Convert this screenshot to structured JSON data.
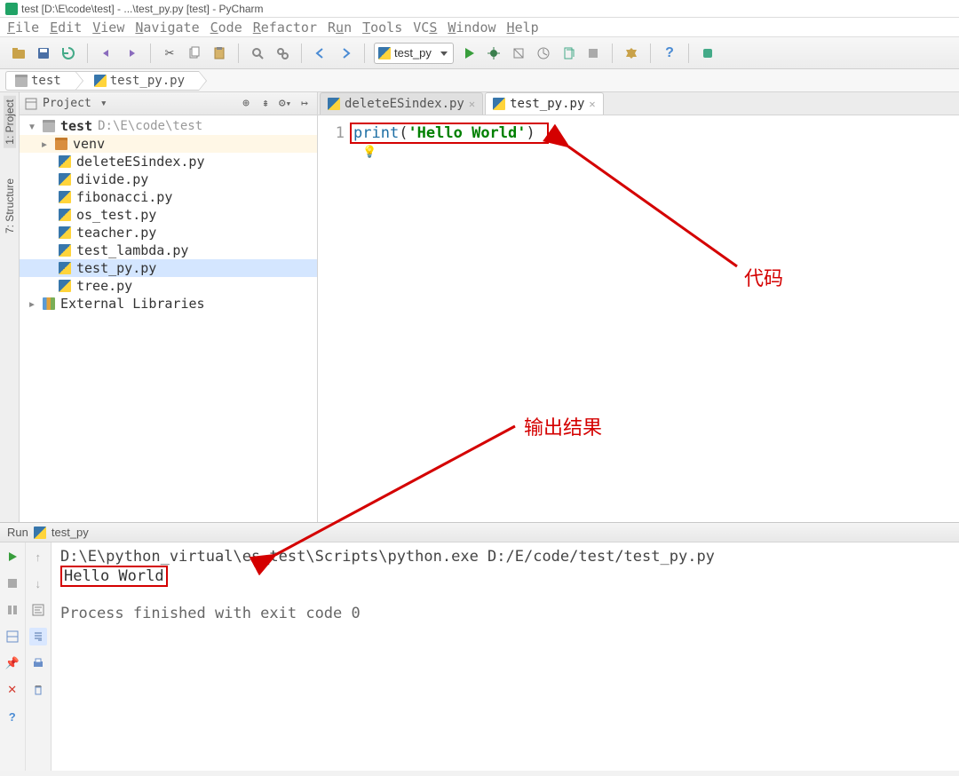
{
  "window": {
    "title": "test [D:\\E\\code\\test] - ...\\test_py.py [test] - PyCharm"
  },
  "menu": {
    "items": [
      "File",
      "Edit",
      "View",
      "Navigate",
      "Code",
      "Refactor",
      "Run",
      "Tools",
      "VCS",
      "Window",
      "Help"
    ]
  },
  "toolbar": {
    "run_config_label": "test_py"
  },
  "breadcrumb": {
    "items": [
      "test",
      "test_py.py"
    ]
  },
  "side_tabs": {
    "project": "1: Project",
    "structure": "7: Structure"
  },
  "project_panel": {
    "header_label": "Project",
    "root_name": "test",
    "root_path": "D:\\E\\code\\test",
    "venv": "venv",
    "files": [
      "deleteESindex.py",
      "divide.py",
      "fibonacci.py",
      "os_test.py",
      "teacher.py",
      "test_lambda.py",
      "test_py.py",
      "tree.py"
    ],
    "external_libs": "External Libraries"
  },
  "tabs": {
    "items": [
      {
        "label": "deleteESindex.py",
        "active": false
      },
      {
        "label": "test_py.py",
        "active": true
      }
    ]
  },
  "editor": {
    "line_number": "1",
    "keyword": "print",
    "open_paren": "(",
    "string": "'Hello World'",
    "close_paren": ")"
  },
  "run_panel": {
    "header_prefix": "Run",
    "header_name": "test_py",
    "cmd_line": "D:\\E\\python_virtual\\es_test\\Scripts\\python.exe D:/E/code/test/test_py.py",
    "output": "Hello World",
    "exit_line": "Process finished with exit code 0"
  },
  "annotations": {
    "code_label": "代码",
    "output_label": "输出结果"
  }
}
